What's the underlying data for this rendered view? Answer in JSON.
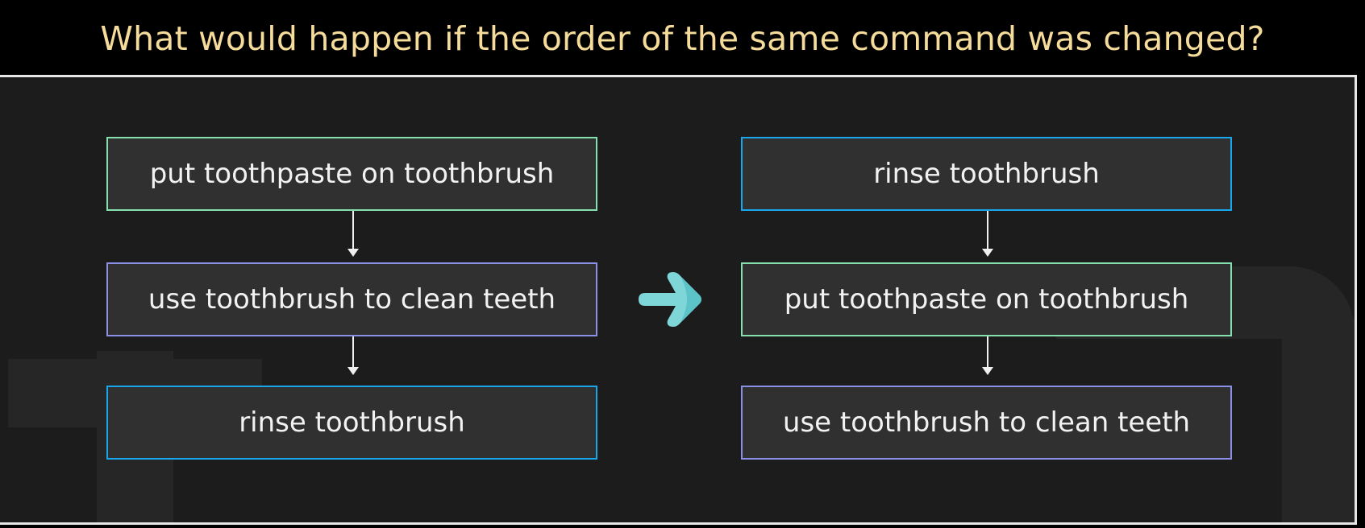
{
  "title": "What would happen if the order of the same command was changed?",
  "colors": {
    "title": "#f5dc9a",
    "green_border": "#86dfae",
    "purple_border": "#8b90e6",
    "blue_border": "#18a6ec",
    "arrow": "#7fd6d8"
  },
  "left_flow": [
    "put toothpaste on toothbrush",
    "use toothbrush to clean teeth",
    "rinse toothbrush"
  ],
  "right_flow": [
    "rinse toothbrush",
    "put toothpaste on toothbrush",
    "use toothbrush to clean teeth"
  ],
  "transition_icon": "arrow-right-icon"
}
